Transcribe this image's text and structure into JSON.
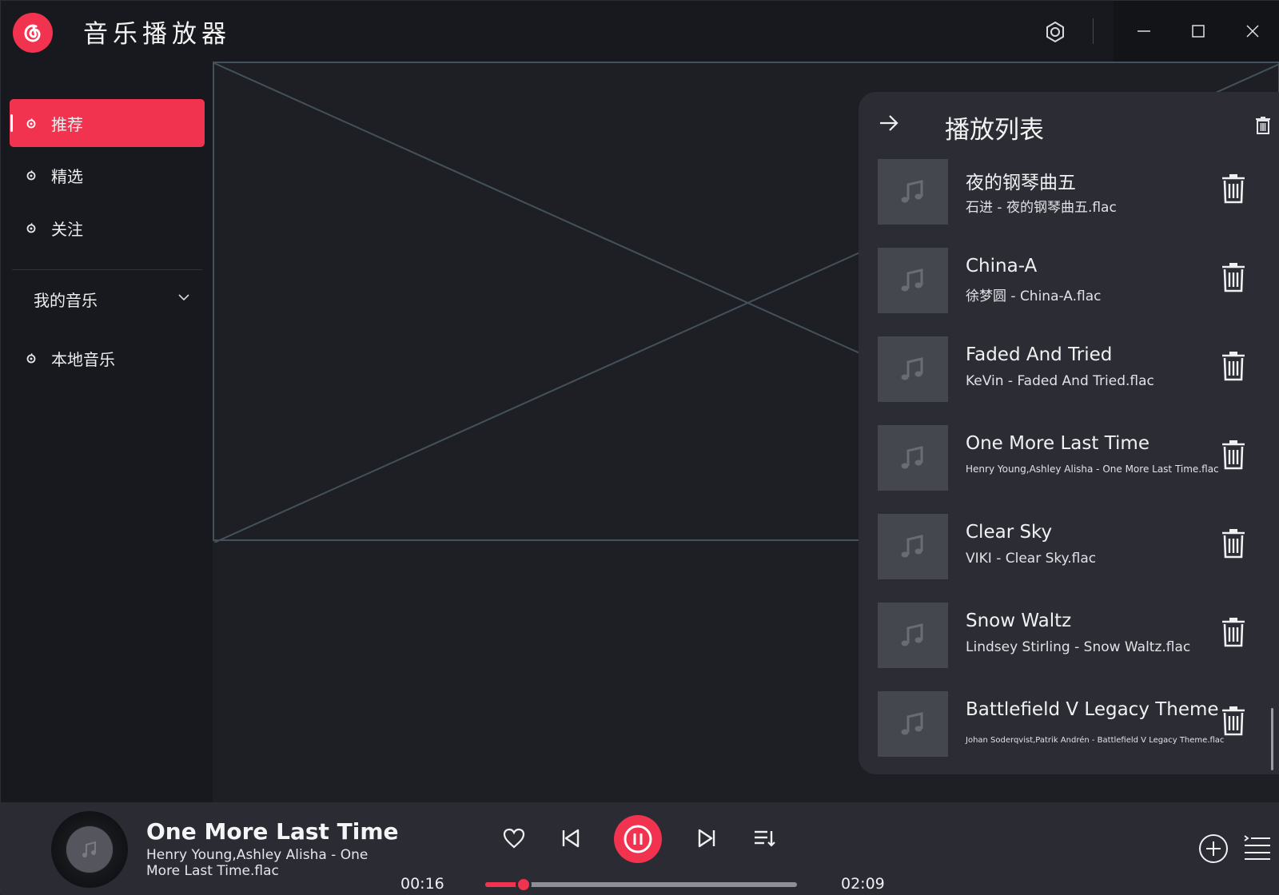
{
  "app": {
    "title": "音乐播放器",
    "accent": "#f2334f"
  },
  "window_controls": {
    "settings": "settings-icon",
    "minimize": "minimize-icon",
    "maximize": "maximize-icon",
    "close": "close-icon"
  },
  "sidebar": {
    "items": [
      {
        "label": "推荐",
        "active": true,
        "icon": "music-logo-icon"
      },
      {
        "label": "精选",
        "active": false,
        "icon": "music-logo-icon"
      },
      {
        "label": "关注",
        "active": false,
        "icon": "music-logo-icon"
      }
    ],
    "my_music": {
      "label": "我的音乐",
      "expanded": false
    },
    "my_music_items": [
      {
        "label": "本地音乐",
        "icon": "music-logo-icon"
      }
    ]
  },
  "playlist": {
    "title": "播放列表",
    "tracks": [
      {
        "title": "夜的钢琴曲五",
        "subtitle": "石进 - 夜的钢琴曲五.flac"
      },
      {
        "title": "China-A",
        "subtitle": "徐梦圆 - China-A.flac"
      },
      {
        "title": "Faded And Tried",
        "subtitle": "KeVin - Faded And Tried.flac"
      },
      {
        "title": "One More Last Time",
        "subtitle": "Henry Young,Ashley Alisha - One More Last Time.flac"
      },
      {
        "title": "Clear Sky",
        "subtitle": "VIKI - Clear Sky.flac"
      },
      {
        "title": "Snow Waltz",
        "subtitle": "Lindsey Stirling - Snow Waltz.flac"
      },
      {
        "title": "Battlefield V Legacy Theme",
        "subtitle": "Johan Soderqvist,Patrik Andrén - Battlefield V Legacy Theme.flac"
      }
    ]
  },
  "player": {
    "title": "One More Last Time",
    "artist": "Henry Young,Ashley Alisha - One More Last Time.flac",
    "current_time": "00:16",
    "total_time": "02:09",
    "progress_fraction": 0.124,
    "state": "playing"
  }
}
